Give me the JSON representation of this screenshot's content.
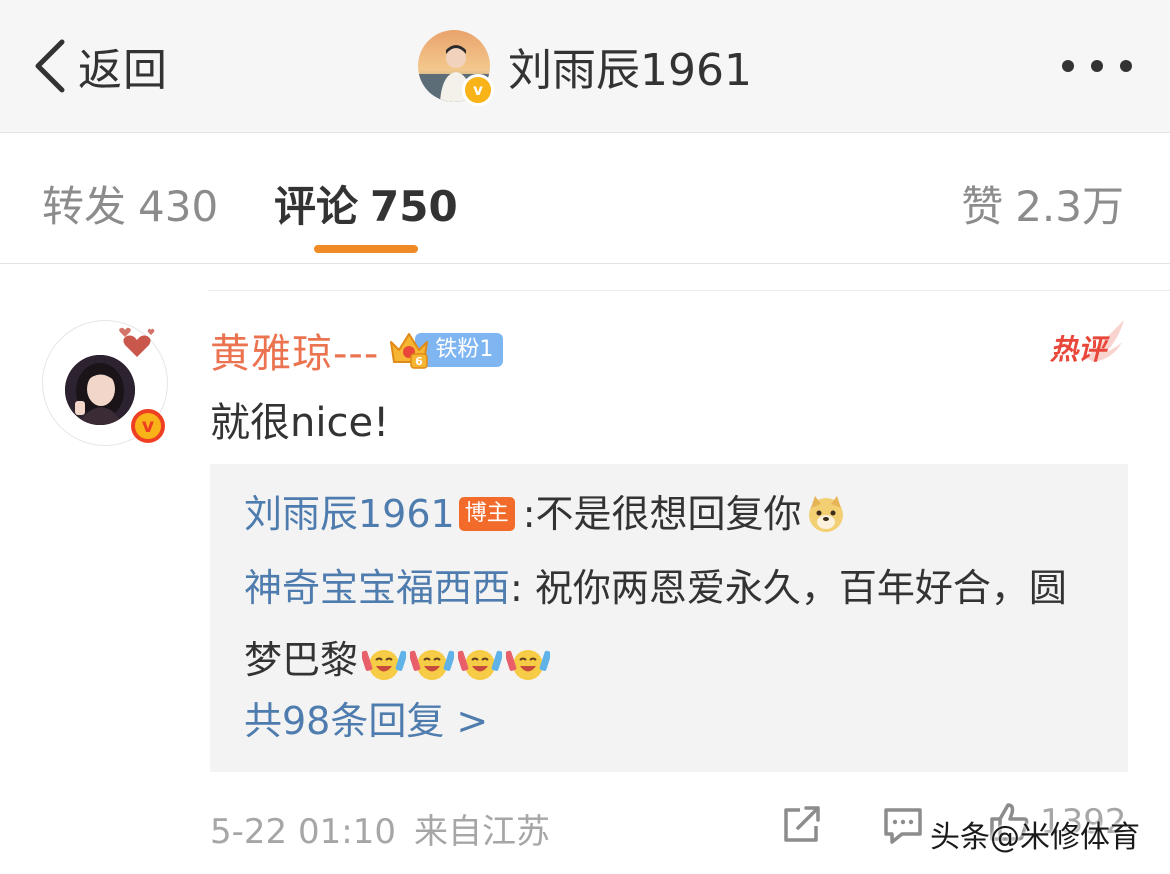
{
  "header": {
    "back_label": "返回",
    "title": "刘雨辰1961",
    "verified_mark": "v"
  },
  "tabs": {
    "forward": {
      "label": "转发",
      "count": "430"
    },
    "comment": {
      "label": "评论",
      "count": "750"
    },
    "like": {
      "label": "赞",
      "count": "2.3万"
    },
    "active": "comment",
    "active_color": "#f08a24"
  },
  "comment": {
    "user_name": "黄雅琼---",
    "fan_badge": "铁粉1",
    "fan_level": "6",
    "verified_mark": "v",
    "hot_label": "热评",
    "text": "就很nice!",
    "time": "5-22 01:10",
    "source": "来自江苏",
    "like_count": "1392"
  },
  "replies": {
    "items": [
      {
        "name": "刘雨辰1961",
        "badge": "博主",
        "text": ":不是很想回复你",
        "emoji": [
          "doge-emoji"
        ]
      },
      {
        "name": "神奇宝宝福西西",
        "badge": "",
        "text": ": 祝你两恩爱永久，百年好合，圆梦巴黎",
        "emoji": [
          "cheer-emoji",
          "cheer-emoji",
          "cheer-emoji",
          "cheer-emoji"
        ]
      }
    ],
    "more_link": "共98条回复 >"
  },
  "watermark": "头条@米修体育",
  "colors": {
    "username": "#eb7350",
    "link_blue": "#4f7cae",
    "host_badge": "#f26b2a",
    "fan_badge": "#7fb6f2",
    "hot": "#e8473a"
  }
}
